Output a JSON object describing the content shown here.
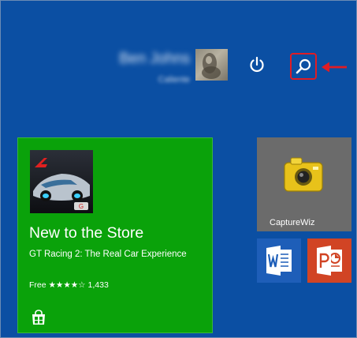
{
  "header": {
    "user_name": "Ben Johns",
    "user_subtitle": "Caliente",
    "power_icon": "power-icon",
    "search_icon": "search-icon",
    "highlight_color": "#e01c24"
  },
  "tiles": {
    "store": {
      "title": "New to the Store",
      "app_name": "GT Racing 2: The Real Car Experience",
      "price": "Free",
      "stars": "★★★★☆",
      "rating_count": "1,433",
      "color": "#0aa20a"
    },
    "capturewiz": {
      "label": "CaptureWiz",
      "color": "#6b6b6b"
    },
    "word": {
      "icon": "word-icon",
      "color": "#1e5eb8"
    },
    "powerpoint": {
      "icon": "powerpoint-icon",
      "color": "#d14424"
    }
  },
  "background_color": "#0b4fa3"
}
